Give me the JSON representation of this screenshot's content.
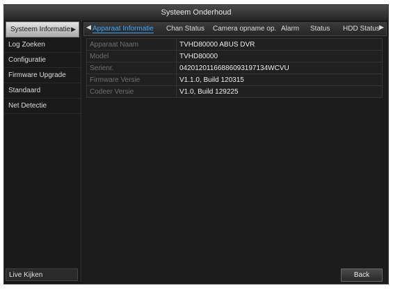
{
  "window": {
    "title": "Systeem Onderhoud"
  },
  "sidebar": {
    "items": [
      {
        "label": "Systeem Informatie"
      },
      {
        "label": "Log Zoeken"
      },
      {
        "label": "Configuratie"
      },
      {
        "label": "Firmware Upgrade"
      },
      {
        "label": "Standaard"
      },
      {
        "label": "Net Detectie"
      }
    ],
    "live_view": "Live Kijken"
  },
  "tabs": [
    {
      "label": "Apparaat Informatie"
    },
    {
      "label": "Chan Status"
    },
    {
      "label": "Camera opname op."
    },
    {
      "label": "Alarm"
    },
    {
      "label": "Status"
    },
    {
      "label": "HDD Status"
    }
  ],
  "info": [
    {
      "label": "Apparaat Naam",
      "value": "TVHD80000 ABUS DVR"
    },
    {
      "label": "Model",
      "value": "TVHD80000"
    },
    {
      "label": "Serienr.",
      "value": "04201201166886093197134WCVU"
    },
    {
      "label": "Firmware Versie",
      "value": "V1.1.0, Build 120315"
    },
    {
      "label": "Codeer Versie",
      "value": "V1.0, Build 129225"
    }
  ],
  "footer": {
    "back_label": "Back"
  }
}
